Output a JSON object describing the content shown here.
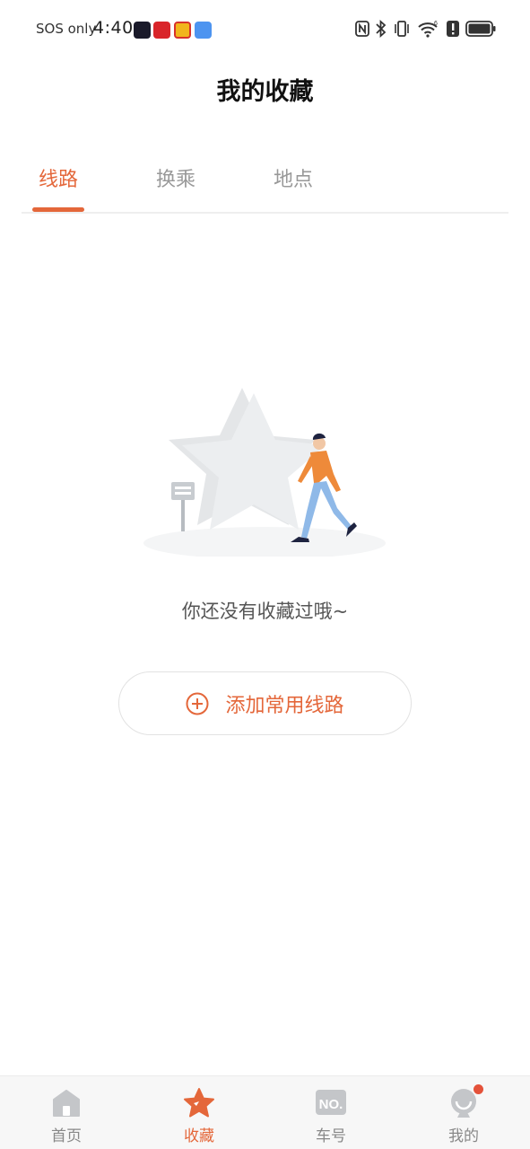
{
  "status_bar": {
    "carrier": "SOS only",
    "time": "4:40",
    "app_icons": [
      "notification-app-1",
      "notification-app-2",
      "notification-app-3",
      "notification-app-4"
    ],
    "system_icons": [
      "nfc-icon",
      "bluetooth-icon",
      "vibrate-icon",
      "wifi-icon",
      "alert-icon",
      "battery-icon"
    ]
  },
  "header": {
    "title": "我的收藏"
  },
  "tabs": [
    {
      "label": "线路",
      "active": true
    },
    {
      "label": "换乘",
      "active": false
    },
    {
      "label": "地点",
      "active": false
    }
  ],
  "empty_state": {
    "message": "你还没有收藏过哦~",
    "action_label": "添加常用线路"
  },
  "bottom_nav": [
    {
      "label": "首页",
      "icon": "home-icon",
      "active": false
    },
    {
      "label": "收藏",
      "icon": "star-icon",
      "active": true
    },
    {
      "label": "车号",
      "icon": "no-icon",
      "active": false
    },
    {
      "label": "我的",
      "icon": "profile-icon",
      "active": false,
      "badge": true
    }
  ],
  "colors": {
    "accent": "#e4673a",
    "inactive": "#999999",
    "divider": "#eeeeee"
  }
}
